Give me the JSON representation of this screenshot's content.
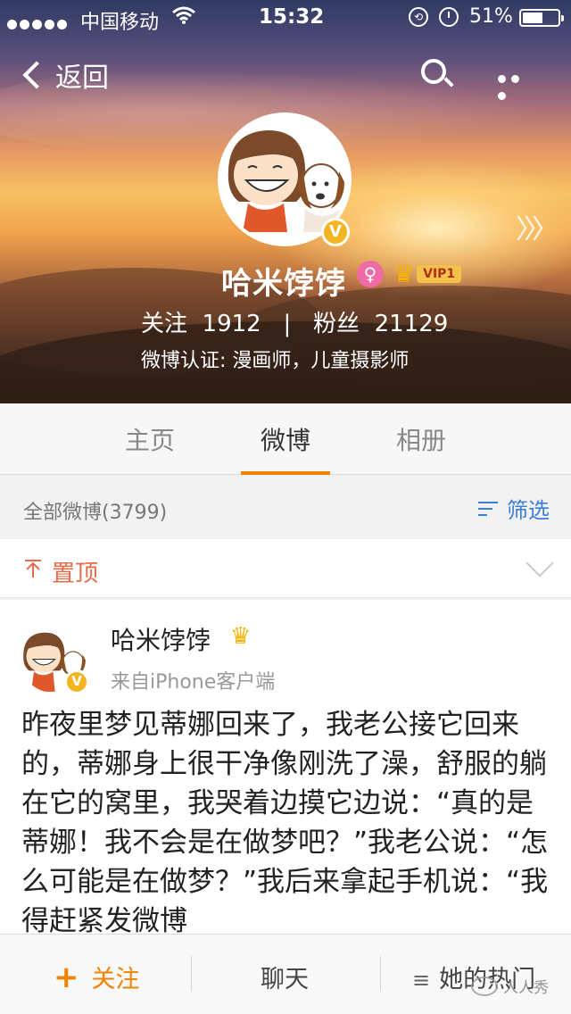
{
  "status_bar": {
    "carrier": "中国移动",
    "time": "15:32",
    "battery": "51%"
  },
  "nav": {
    "back_label": "返回"
  },
  "profile": {
    "name": "哈米饽饽",
    "vip_label": "VIP1",
    "follow_stats": "关注  1912   |   粉丝  21129",
    "verified_desc": "微博认证: 漫画师，儿童摄影师",
    "verified_badge": "V"
  },
  "tabs": [
    {
      "label": "主页"
    },
    {
      "label": "微博"
    },
    {
      "label": "相册"
    }
  ],
  "filter": {
    "count_label": "全部微博(3799)",
    "filter_label": "筛选"
  },
  "pinned": {
    "label": "置顶"
  },
  "post": {
    "author": "哈米饽饽",
    "source": "来自iPhone客户端",
    "text": "昨夜里梦见蒂娜回来了，我老公接它回来的，蒂娜身上很干净像刚洗了澡，舒服的躺在它的窝里，我哭着边摸它边说：“真的是蒂娜！我不会是在做梦吧？”我老公说：“怎么可能是在做梦？”我后来拿起手机说：“我得赶紧发微博"
  },
  "toolbar": {
    "follow_plus": "+",
    "follow_label": "关注",
    "chat_label": "聊天",
    "hot_menu": "≡",
    "hot_label": "她的热门"
  },
  "watermark": "人人秀",
  "colors": {
    "accent": "#f08300",
    "link": "#3b7dd8",
    "pinned": "#e86a4a",
    "verify": "#f2b521"
  }
}
